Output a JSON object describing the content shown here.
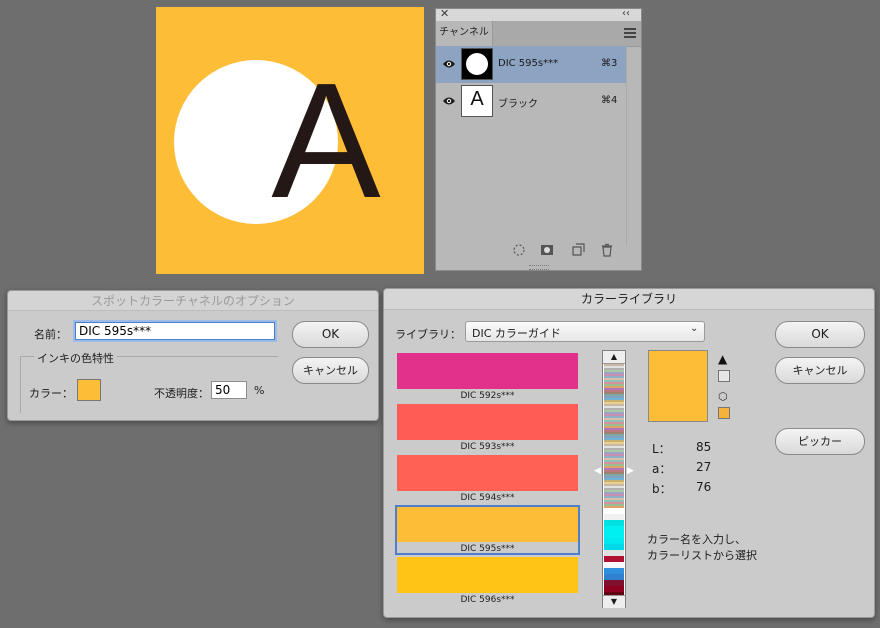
{
  "canvas": {
    "letter": "A",
    "background": "#febd37",
    "circle_color": "#ffffff",
    "letter_color": "#231815"
  },
  "channels_panel": {
    "tab_label": "チャンネル",
    "channels": [
      {
        "name": "DIC 595s***",
        "shortcut": "⌘3",
        "selected": true,
        "thumb": "circle"
      },
      {
        "name": "ブラック",
        "shortcut": "⌘4",
        "selected": false,
        "thumb": "A"
      }
    ]
  },
  "spot_dialog": {
    "title": "スポットカラーチャネルのオプション",
    "name_label": "名前：",
    "name_value": "DIC 595s***",
    "ink_group_title": "インキの色特性",
    "color_label": "カラー：",
    "color_swatch": "#febd37",
    "opacity_label": "不透明度：",
    "opacity_value": "50",
    "opacity_unit": "%",
    "ok_label": "OK",
    "cancel_label": "キャンセル"
  },
  "library_dialog": {
    "title": "カラーライブラリ",
    "library_label": "ライブラリ：",
    "library_value": "DIC カラーガイド",
    "swatches": [
      {
        "name": "DIC 592s***",
        "color": "#e1318b"
      },
      {
        "name": "DIC 593s***",
        "color": "#ff5c56"
      },
      {
        "name": "DIC 594s***",
        "color": "#ff6154"
      },
      {
        "name": "DIC 595s***",
        "color": "#febd37"
      },
      {
        "name": "DIC 596s***",
        "color": "#ffc416"
      }
    ],
    "selected_index": 3,
    "preview_color": "#febd37",
    "warning_icon": "warning-icon",
    "cube_icon": "web-cube-icon",
    "websafe_color": "#f6b23a",
    "lab": [
      {
        "key": "L：",
        "value": "85"
      },
      {
        "key": "a：",
        "value": "27"
      },
      {
        "key": "b：",
        "value": "76"
      }
    ],
    "hint_line1": "カラー名を入力し、",
    "hint_line2": "カラーリストから選択",
    "ok_label": "OK",
    "cancel_label": "キャンセル",
    "picker_label": "ピッカー"
  }
}
